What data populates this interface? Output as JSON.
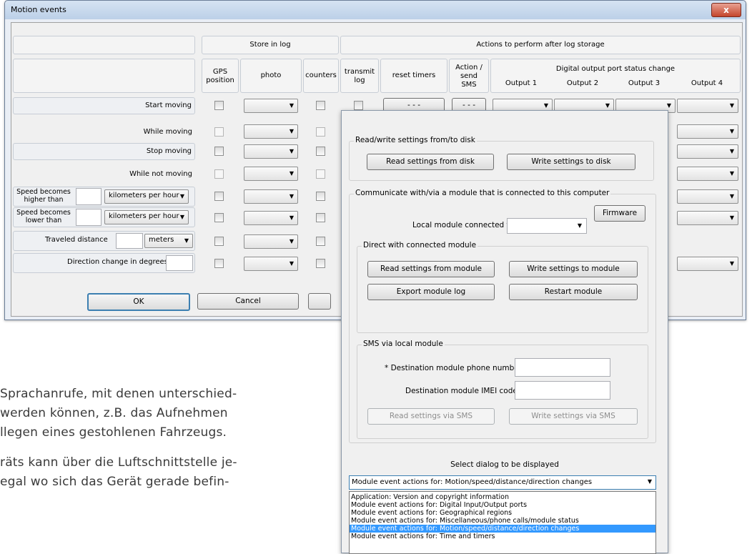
{
  "doc_lines": [
    "Sprachanrufe, mit denen unterschied-",
    "werden können, z.B. das Aufnehmen",
    "llegen eines gestohlenen Fahrzeugs.",
    "räts kann über die Luftschnittstelle je-",
    "egal wo sich das Gerät gerade befin-"
  ],
  "motion_window": {
    "title": "Motion events",
    "close_glyph": "x",
    "headers": {
      "store_in_log": "Store in log",
      "actions_after": "Actions to perform after log storage",
      "gps_position": "GPS position",
      "photo": "photo",
      "counters": "counters",
      "transmit_log": "transmit log",
      "reset_timers": "reset timers",
      "action_send_sms": "Action / send SMS",
      "digital_output": "Digital output port status change",
      "output1": "Output 1",
      "output2": "Output 2",
      "output3": "Output 3",
      "output4": "Output 4"
    },
    "rows": {
      "start_moving": "Start moving",
      "while_moving": "While moving",
      "stop_moving": "Stop moving",
      "while_not_moving": "While not moving",
      "speed_higher": "Speed becomes higher than",
      "speed_lower": "Speed becomes lower than",
      "traveled_distance": "Traveled distance",
      "direction_change": "Direction change in degrees"
    },
    "units": {
      "kmh1": "kilometers per hour",
      "kmh2": "kilometers per hour",
      "meters": "meters"
    },
    "dots": "- - -",
    "ok": "OK",
    "cancel": "Cancel"
  },
  "settings_dialog": {
    "rw_group": "Read/write settings from/to disk",
    "read_disk": "Read settings from disk",
    "write_disk": "Write settings to disk",
    "comm_group": "Communicate with/via a module that is connected to this computer",
    "firmware": "Firmware",
    "local_module": "Local module connected to",
    "direct_group": "Direct with connected module",
    "read_module": "Read settings from module",
    "write_module": "Write settings to module",
    "export_log": "Export module log",
    "restart": "Restart module",
    "sms_group": "SMS via local module",
    "dest_phone": "* Destination module phone number",
    "dest_imei": "Destination module IMEI code",
    "read_sms": "Read settings via SMS",
    "write_sms": "Write settings via SMS",
    "select_label": "Select dialog to be displayed",
    "selected": "Module event actions for: Motion/speed/distance/direction changes",
    "options": [
      "Application: Version and copyright information",
      "Module event actions for: Digital Input/Output ports",
      "Module event actions for: Geographical regions",
      "Module event actions for: Miscellaneous/phone calls/module status",
      "Module event actions for: Motion/speed/distance/direction changes",
      "Module event actions for: Time and timers"
    ]
  }
}
